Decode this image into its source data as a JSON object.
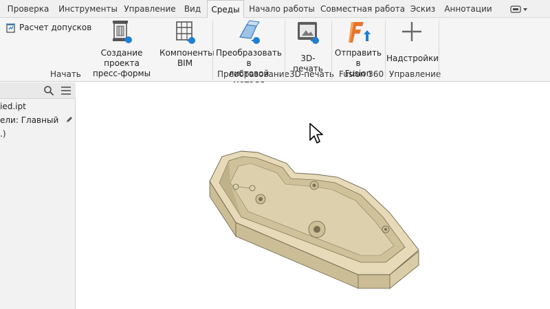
{
  "tabs": [
    {
      "label": "Проверка"
    },
    {
      "label": "Инструменты"
    },
    {
      "label": "Управление"
    },
    {
      "label": "Вид"
    },
    {
      "label": "Среды",
      "active": true
    },
    {
      "label": "Начало работы"
    },
    {
      "label": "Совместная работа"
    },
    {
      "label": "Эскиз"
    },
    {
      "label": "Аннотации"
    }
  ],
  "ribbon": {
    "tolerance_label": "Расчет допусков",
    "mold_line1": "Создание проекта",
    "mold_line2": "пресс-формы",
    "bim_line1": "Компоненты",
    "bim_line2": "BIM",
    "panel_start": "Начать",
    "sheet_line1": "Преобразовать в",
    "sheet_line2": "листовой металл",
    "panel_convert": "Преобразование",
    "print_label": "3D-печать",
    "panel_print": "3D-печать",
    "fusion_line1": "Отправить в",
    "fusion_line2": "Fusion",
    "panel_fusion": "Fusion 360",
    "addins_label": "Надстройки",
    "panel_manage": "Управление"
  },
  "browser": {
    "file": "ied.ipt",
    "view_rep": "ели: Главный",
    "item3": ".)"
  },
  "colors": {
    "accent_blue": "#1e7fd6",
    "fusion_orange": "#e8742c",
    "part_body": "#e3d6b4",
    "part_edge": "#6b6248"
  }
}
